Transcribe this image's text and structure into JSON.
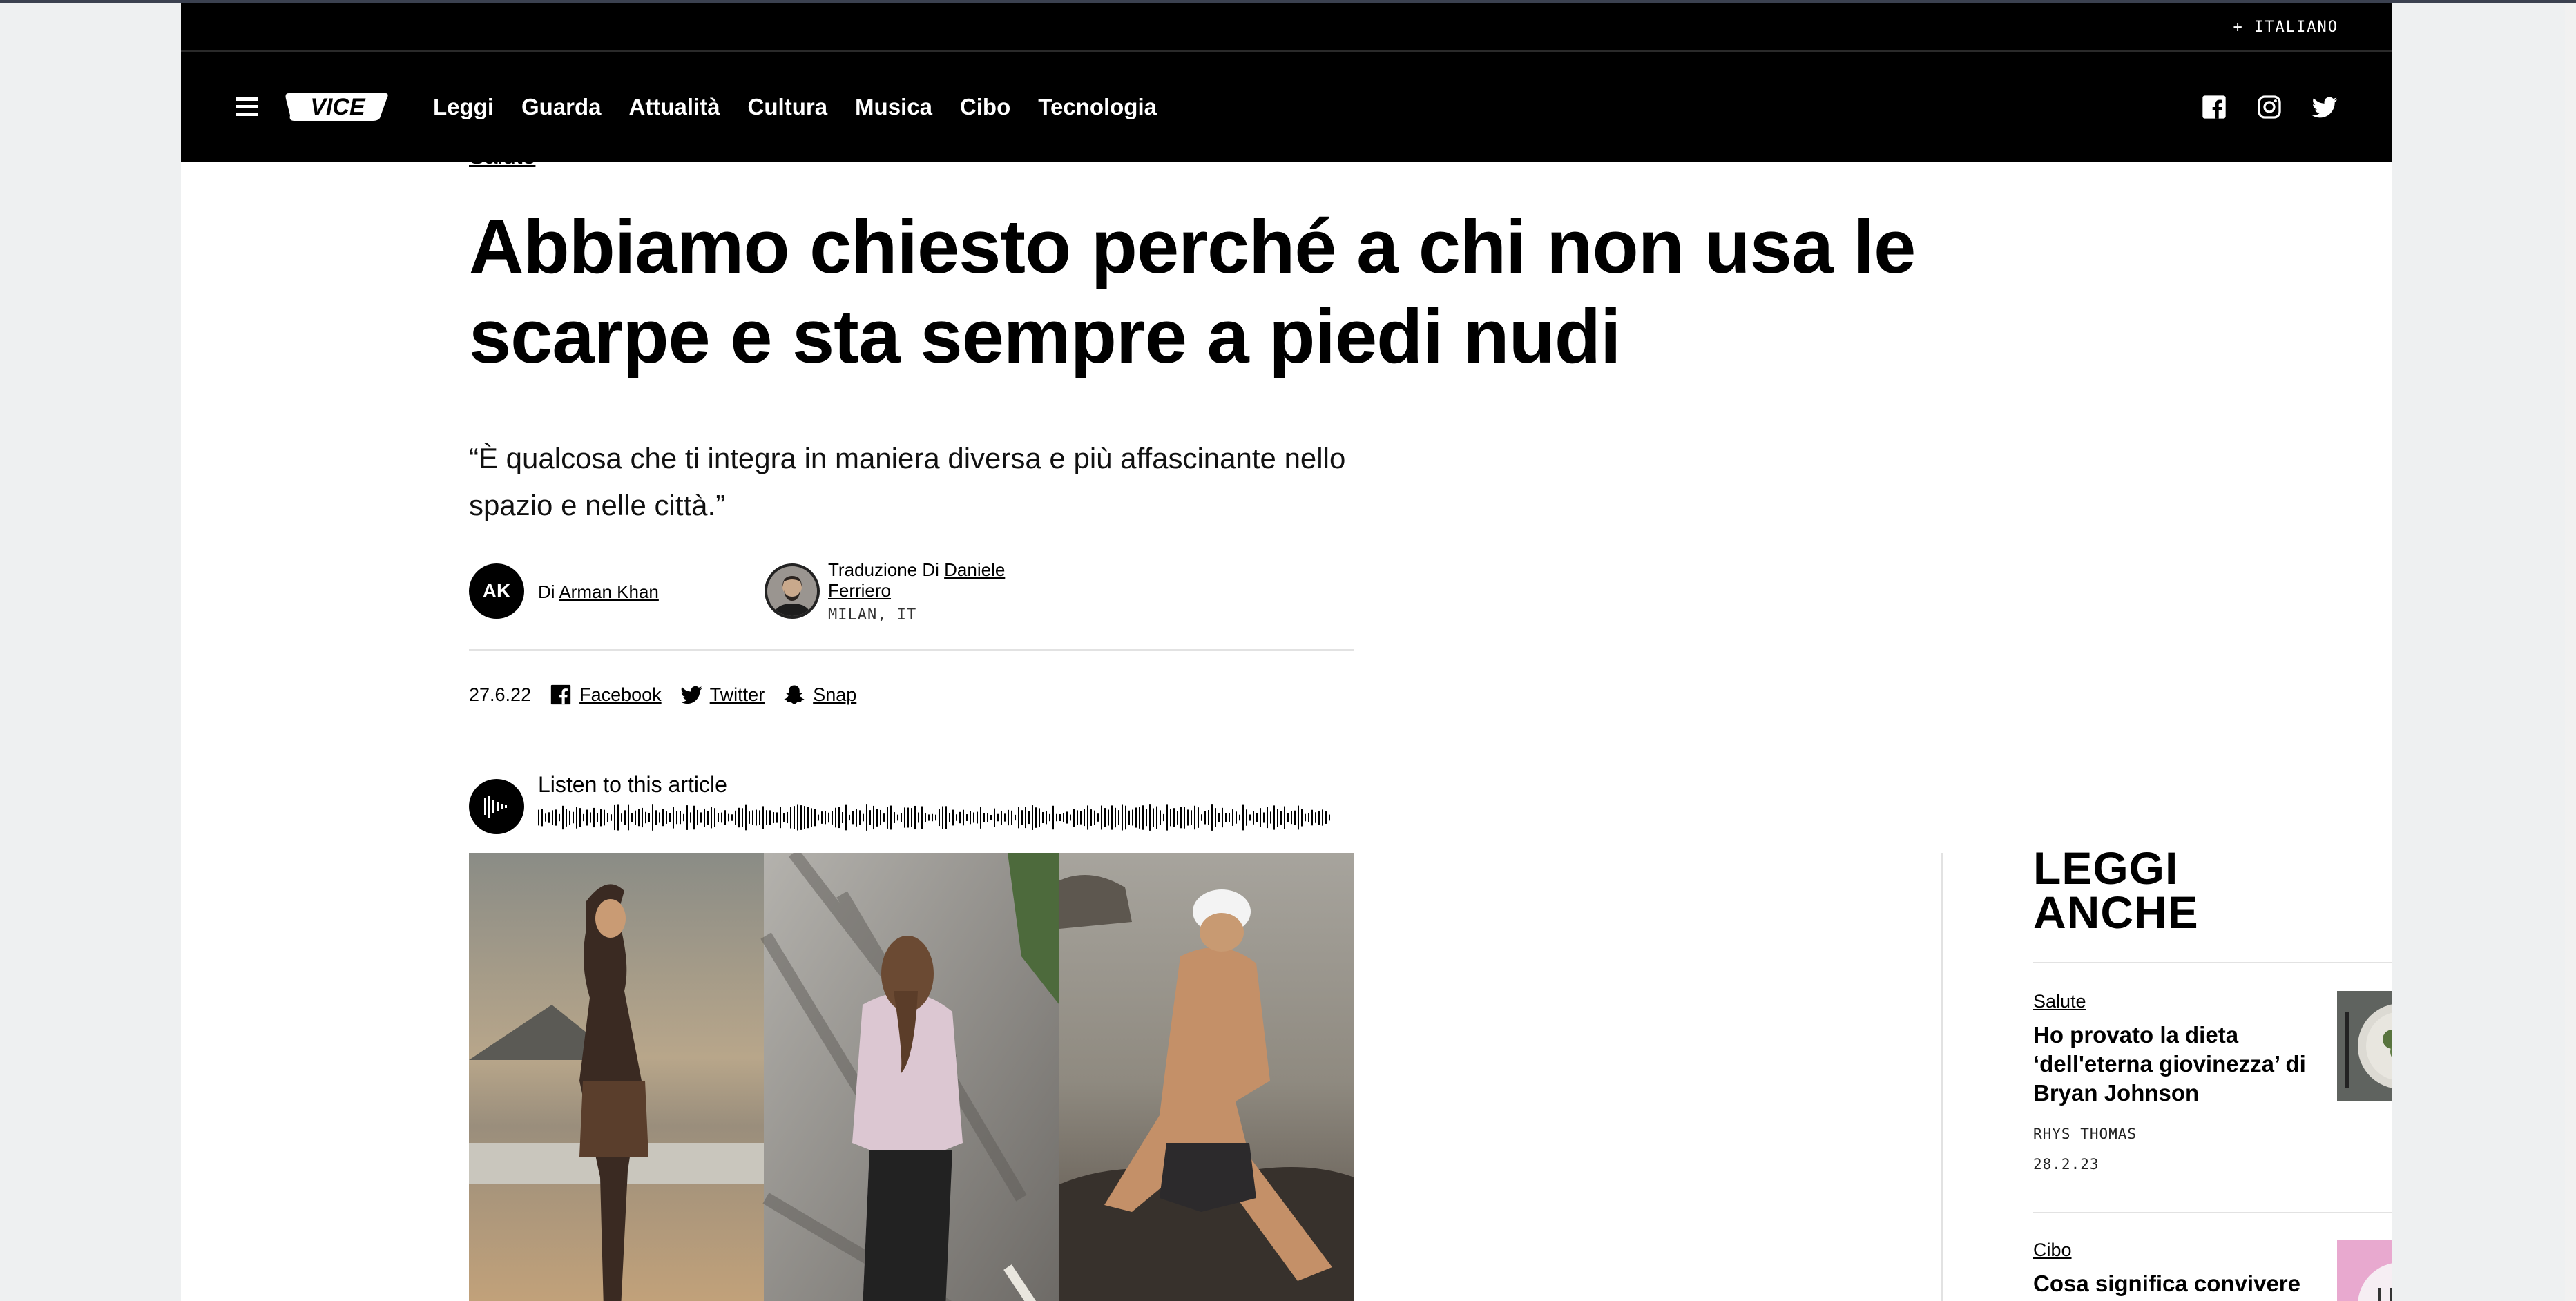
{
  "lang": "+ ITALIANO",
  "nav": {
    "logo": "VICE",
    "links": [
      "Leggi",
      "Guarda",
      "Attualità",
      "Cultura",
      "Musica",
      "Cibo",
      "Tecnologia"
    ],
    "social": [
      "facebook-icon",
      "instagram-icon",
      "twitter-icon"
    ]
  },
  "article": {
    "category": "Salute",
    "title": "Abbiamo chiesto perché a chi non usa le scarpe e sta sempre a piedi nudi",
    "dek": "“È qualcosa che ti integra in maniera diversa e più affascinante nello spazio e nelle città.”",
    "author_initials": "AK",
    "author_prefix": "Di ",
    "author_name": "Arman Khan",
    "translator_prefix": "Traduzione Di ",
    "translator_name": "Daniele Ferriero",
    "location": "MILAN, IT",
    "date": "27.6.22",
    "share": [
      {
        "label": "Facebook",
        "icon": "facebook-icon"
      },
      {
        "label": "Twitter",
        "icon": "twitter-icon"
      },
      {
        "label": "Snap",
        "icon": "snapchat-icon"
      }
    ],
    "listen_label": "Listen to this article"
  },
  "rail": {
    "title": "LEGGI ANCHE",
    "cards": [
      {
        "category": "Salute",
        "headline": "Ho provato la dieta ‘dell'eterna giovinezza’ di Bryan Johnson",
        "author": "RHYS THOMAS",
        "date": "28.2.23"
      },
      {
        "category": "Cibo",
        "headline": "Cosa significa convivere"
      }
    ]
  },
  "colors": {
    "nav_bg": "#000000",
    "page_bg": "#ffffff",
    "outer_bg": "#eef0f1"
  }
}
